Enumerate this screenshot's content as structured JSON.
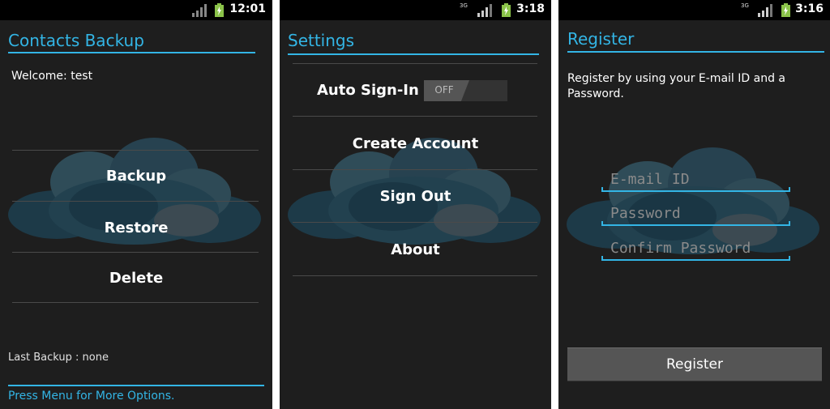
{
  "screens": [
    {
      "status": {
        "time": "12:01"
      },
      "title": "Contacts Backup",
      "welcome": "Welcome: test",
      "menu": [
        "Backup",
        "Restore",
        "Delete"
      ],
      "last_backup": "Last Backup : none",
      "hint": "Press Menu for More Options."
    },
    {
      "status": {
        "time": "3:18",
        "network": "3G"
      },
      "title": "Settings",
      "auto_sign_in_label": "Auto Sign-In",
      "toggle_state": "OFF",
      "menu": [
        "Create Account",
        "Sign Out",
        "About"
      ]
    },
    {
      "status": {
        "time": "3:16",
        "network": "3G"
      },
      "title": "Register",
      "instructions_line1": "Register by using your E-mail ID and a",
      "instructions_line2": "Password.",
      "fields": [
        "E-mail ID",
        "Password",
        "Confirm Password"
      ],
      "register_button": "Register"
    }
  ],
  "colors": {
    "accent": "#33b5e5",
    "background": "#1e1e1e",
    "battery": "#8bc34a"
  },
  "icons": [
    "signal-icon",
    "battery-icon",
    "network-3g-icon",
    "cloud-icon"
  ]
}
